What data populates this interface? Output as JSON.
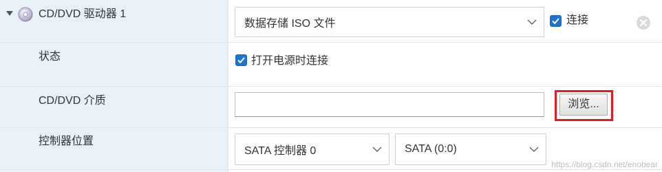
{
  "device": {
    "expand_icon": "triangle-down-icon",
    "device_icon": "cd-disc-icon",
    "title": "CD/DVD 驱动器 1",
    "type_select_value": "数据存储 ISO 文件",
    "connected_label": "连接",
    "connected_checked": true,
    "remove_icon": "close-circle-icon"
  },
  "rows": {
    "status": {
      "label": "状态",
      "power_on_label": "打开电源时连接",
      "power_on_checked": true
    },
    "media": {
      "label": "CD/DVD 介质",
      "path_value": "",
      "browse_label": "浏览..."
    },
    "controller": {
      "label": "控制器位置",
      "controller_value": "SATA 控制器 0",
      "port_value": "SATA (0:0)"
    }
  },
  "watermark": "https://blog.csdn.net/enobear",
  "colors": {
    "left_column_bg": "#e8f1f7",
    "checkbox": "#1f74d0",
    "highlight_border": "#e41b23"
  }
}
